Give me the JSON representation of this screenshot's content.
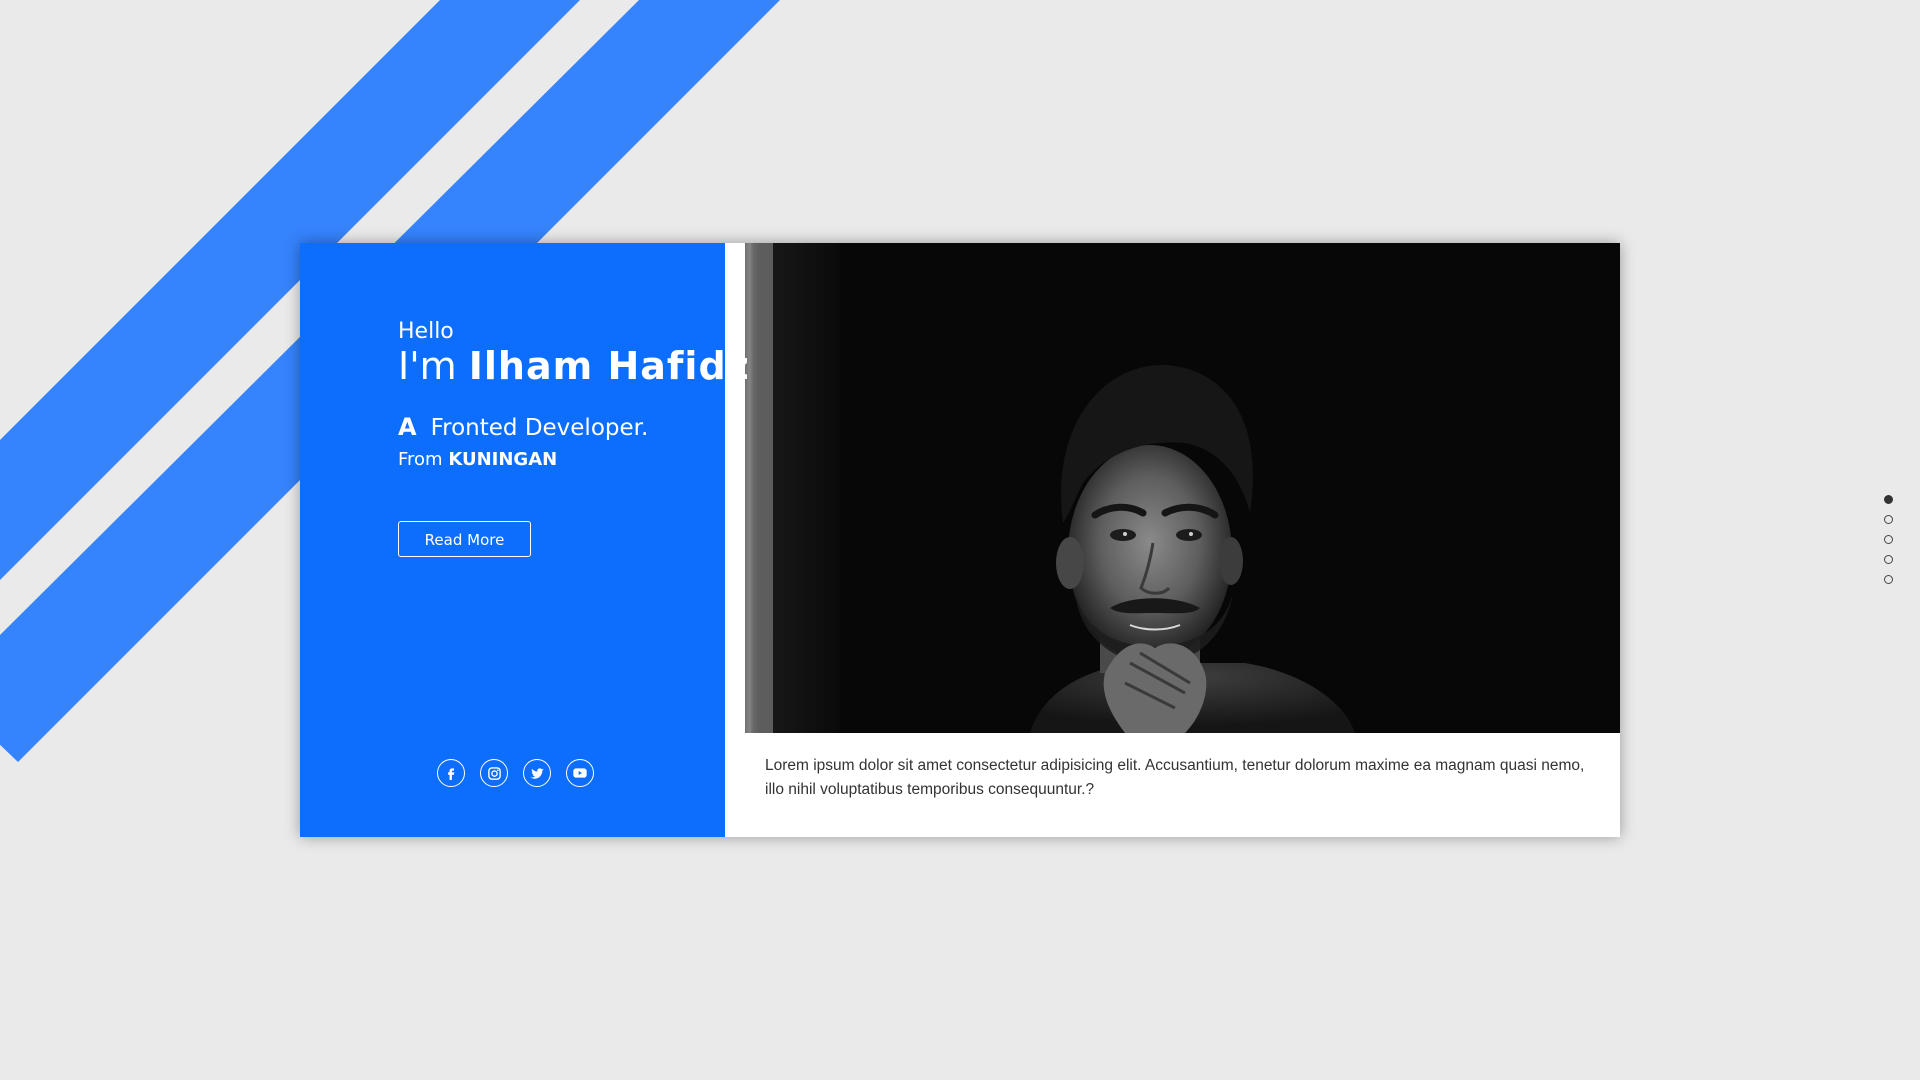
{
  "hero": {
    "greeting": "Hello",
    "name_prefix": "I'm",
    "name": "Ilham Hafidz",
    "role_article": "A",
    "role": "Fronted Developer.",
    "from_label": "From",
    "city": "KUNINGAN"
  },
  "cta": {
    "read_more_label": "Read More"
  },
  "about": {
    "description": "Lorem ipsum dolor sit amet consectetur adipisicing elit. Accusantium, tenetur dolorum maxime ea magnam quasi nemo, illo nihil voluptatibus temporibus consequuntur.?"
  },
  "socials": [
    {
      "icon": "facebook-icon"
    },
    {
      "icon": "instagram-icon"
    },
    {
      "icon": "twitter-icon"
    },
    {
      "icon": "youtube-icon"
    }
  ],
  "pagination": {
    "total": 5,
    "active_index": 0
  },
  "colors": {
    "accent": "#0d6efd",
    "stripe": "#3583fd",
    "background": "#eaeaea",
    "photo_bg": "#070707"
  }
}
